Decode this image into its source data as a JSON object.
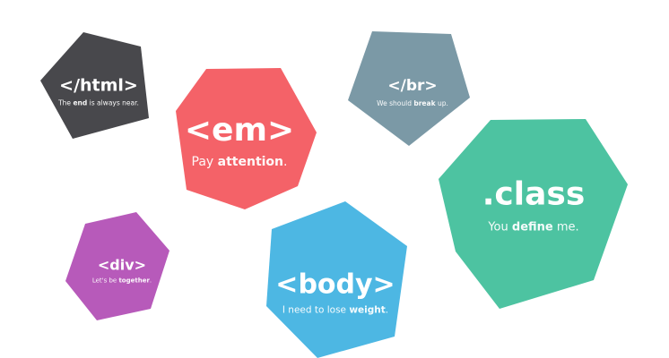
{
  "badges": {
    "html": {
      "tag": "</html>",
      "pre": "The ",
      "bold": "end",
      "post": " is always near.",
      "color": "#48484c"
    },
    "em": {
      "tag": "<em>",
      "pre": "Pay ",
      "bold": "attention",
      "post": ".",
      "color": "#f46268"
    },
    "br": {
      "tag": "</br>",
      "pre": "We should ",
      "bold": "break",
      "post": " up.",
      "color": "#7b99a6"
    },
    "class": {
      "tag": ".class",
      "pre": "You ",
      "bold": "define",
      "post": " me.",
      "color": "#4dc3a1"
    },
    "div": {
      "tag": "<div>",
      "pre": "Let's be ",
      "bold": "together",
      "post": ".",
      "color": "#b75aba"
    },
    "body": {
      "tag": "<body>",
      "pre": "I need to lose ",
      "bold": "weight",
      "post": ".",
      "color": "#4db7e3"
    }
  }
}
